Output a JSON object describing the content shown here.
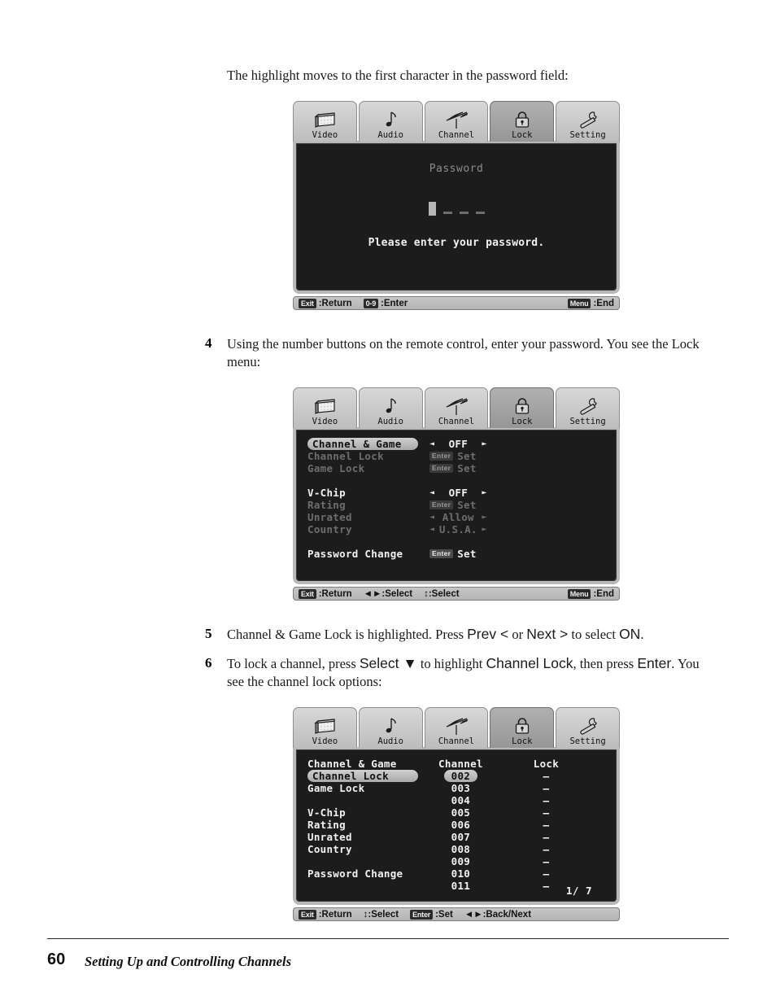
{
  "page": {
    "intro_text": "The highlight moves to the first character in the password field:",
    "footer_number": "60",
    "footer_title": "Setting Up and Controlling Channels"
  },
  "steps": [
    {
      "number": "4",
      "line1_a": "Using the number buttons on the remote control, enter your password. You see the Lock",
      "line2": "menu:"
    },
    {
      "number": "5",
      "part1": "Channel & Game Lock is highlighted. Press ",
      "key1": "Prev <",
      "part2": " or ",
      "key2": "Next >",
      "part3": " to select ",
      "key3": "ON",
      "part4": "."
    },
    {
      "number": "6",
      "part1": "To lock a channel, press ",
      "key1": "Select ▼",
      "part2": " to highlight ",
      "key2": "Channel Lock",
      "part3": ", then press ",
      "key3": "Enter",
      "part4": ". You",
      "line2": "see the channel lock options:"
    }
  ],
  "osd_tabs": [
    {
      "label": "Video",
      "icon": "tv-icon",
      "selected": false
    },
    {
      "label": "Audio",
      "icon": "music-note-icon",
      "selected": false
    },
    {
      "label": "Channel",
      "icon": "antenna-icon",
      "selected": false
    },
    {
      "label": "Lock",
      "icon": "padlock-icon",
      "selected": true
    },
    {
      "label": "Setting",
      "icon": "wrench-icon",
      "selected": false
    }
  ],
  "password_screen": {
    "title": "Password",
    "message": "Please enter your password.",
    "cursor_count": 1,
    "dash_count": 3,
    "status_left": [
      {
        "keycap": "Exit",
        "label": ":Return"
      },
      {
        "keycap": "0-9",
        "label": ":Enter"
      }
    ],
    "status_right": {
      "keycap": "Menu",
      "label": ":End"
    }
  },
  "lock_menu": {
    "rows": [
      {
        "label": "Channel & Game",
        "selected": true,
        "dim": false,
        "control": "arrows",
        "value": "OFF"
      },
      {
        "label": "Channel Lock",
        "selected": false,
        "dim": true,
        "control": "enter-set",
        "keycap": "Enter",
        "value": "Set"
      },
      {
        "label": "Game Lock",
        "selected": false,
        "dim": true,
        "control": "enter-set",
        "keycap": "Enter",
        "value": "Set"
      },
      {
        "label": "",
        "control": "spacer"
      },
      {
        "label": "V-Chip",
        "selected": false,
        "dim": false,
        "control": "arrows",
        "value": "OFF"
      },
      {
        "label": "Rating",
        "selected": false,
        "dim": true,
        "control": "enter-set",
        "keycap": "Enter",
        "value": "Set"
      },
      {
        "label": "Unrated",
        "selected": false,
        "dim": true,
        "control": "arrows",
        "value": "Allow"
      },
      {
        "label": "Country",
        "selected": false,
        "dim": true,
        "control": "arrows",
        "value": "U.S.A."
      },
      {
        "label": "",
        "control": "spacer"
      },
      {
        "label": "Password Change",
        "selected": false,
        "dim": false,
        "control": "enter-set",
        "keycap": "Enter",
        "value": "Set"
      }
    ],
    "status_left": [
      {
        "keycap": "Exit",
        "label": ":Return"
      },
      {
        "keycap": "",
        "label": "◄►:Select"
      },
      {
        "keycap": "",
        "label": "↕:Select"
      }
    ],
    "status_right": {
      "keycap": "Menu",
      "label": ":End"
    }
  },
  "channel_lock_menu": {
    "left_rows": [
      {
        "label": "Channel & Game",
        "selected": false
      },
      {
        "label": "Channel Lock",
        "selected": true
      },
      {
        "label": "Game Lock",
        "selected": false
      },
      {
        "label": "",
        "selected": false
      },
      {
        "label": "V-Chip",
        "selected": false
      },
      {
        "label": "Rating",
        "selected": false
      },
      {
        "label": "Unrated",
        "selected": false
      },
      {
        "label": "Country",
        "selected": false
      },
      {
        "label": "",
        "selected": false
      },
      {
        "label": "Password Change",
        "selected": false
      }
    ],
    "channel_header": "Channel",
    "lock_header": "Lock",
    "channels": [
      "002",
      "003",
      "004",
      "005",
      "006",
      "007",
      "008",
      "009",
      "010",
      "011"
    ],
    "locks": [
      "–",
      "–",
      "–",
      "–",
      "–",
      "–",
      "–",
      "–",
      "–",
      "–"
    ],
    "selected_channel_index": 0,
    "page_indicator": "1/ 7",
    "status_left": [
      {
        "keycap": "Exit",
        "label": ":Return"
      },
      {
        "keycap": "",
        "label": "↕:Select"
      },
      {
        "keycap": "Enter",
        "label": ":Set"
      },
      {
        "keycap": "",
        "label": "◄►:Back/Next"
      }
    ],
    "status_right": {
      "keycap": "",
      "label": ""
    }
  },
  "colors": {
    "osd_bg": "#1c1c1c",
    "osd_chrome": "#b9b9b9",
    "osd_text": "#f2f2f2",
    "osd_dim_text": "#6d6d6d"
  }
}
